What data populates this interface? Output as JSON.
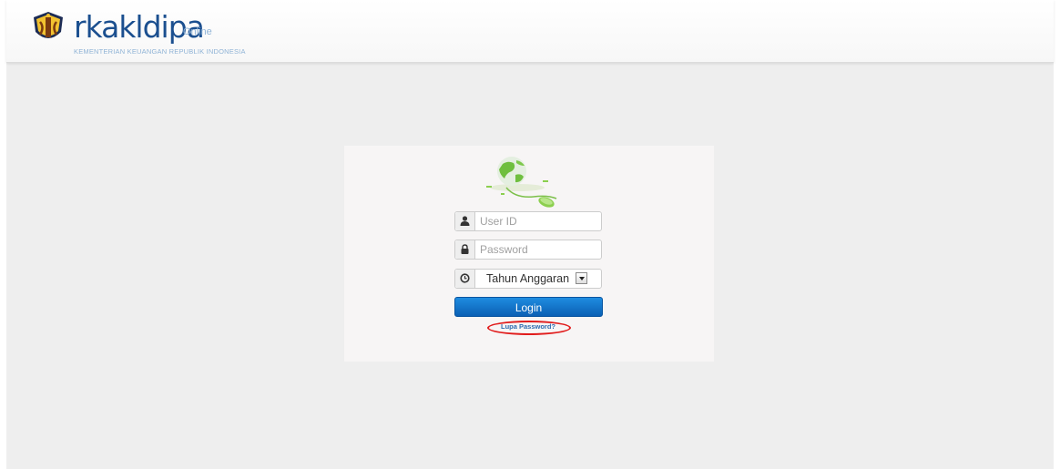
{
  "header": {
    "brand_name": "rkakldipa",
    "brand_suffix": "Online",
    "tagline": "KEMENTERIAN KEUANGAN REPUBLIK INDONESIA",
    "logo_icon": "kemenkeu-emblem-icon"
  },
  "login": {
    "illustration_icon": "globe-mouse-icon",
    "user_icon": "user-icon",
    "user_placeholder": "User ID",
    "user_value": "",
    "password_icon": "lock-icon",
    "password_placeholder": "Password",
    "password_value": "",
    "year_icon": "clock-icon",
    "year_selected": "Tahun Anggaran",
    "year_dropdown_icon": "chevron-down-icon",
    "login_label": "Login",
    "forgot_label": "Lupa Password?"
  },
  "colors": {
    "brand": "#1b4f8f",
    "button_top": "#1f8ce0",
    "button_bottom": "#0b60b4",
    "highlight": "#e11c1c",
    "page_background": "#eeeeee",
    "panel_background": "#f7f5f5"
  }
}
